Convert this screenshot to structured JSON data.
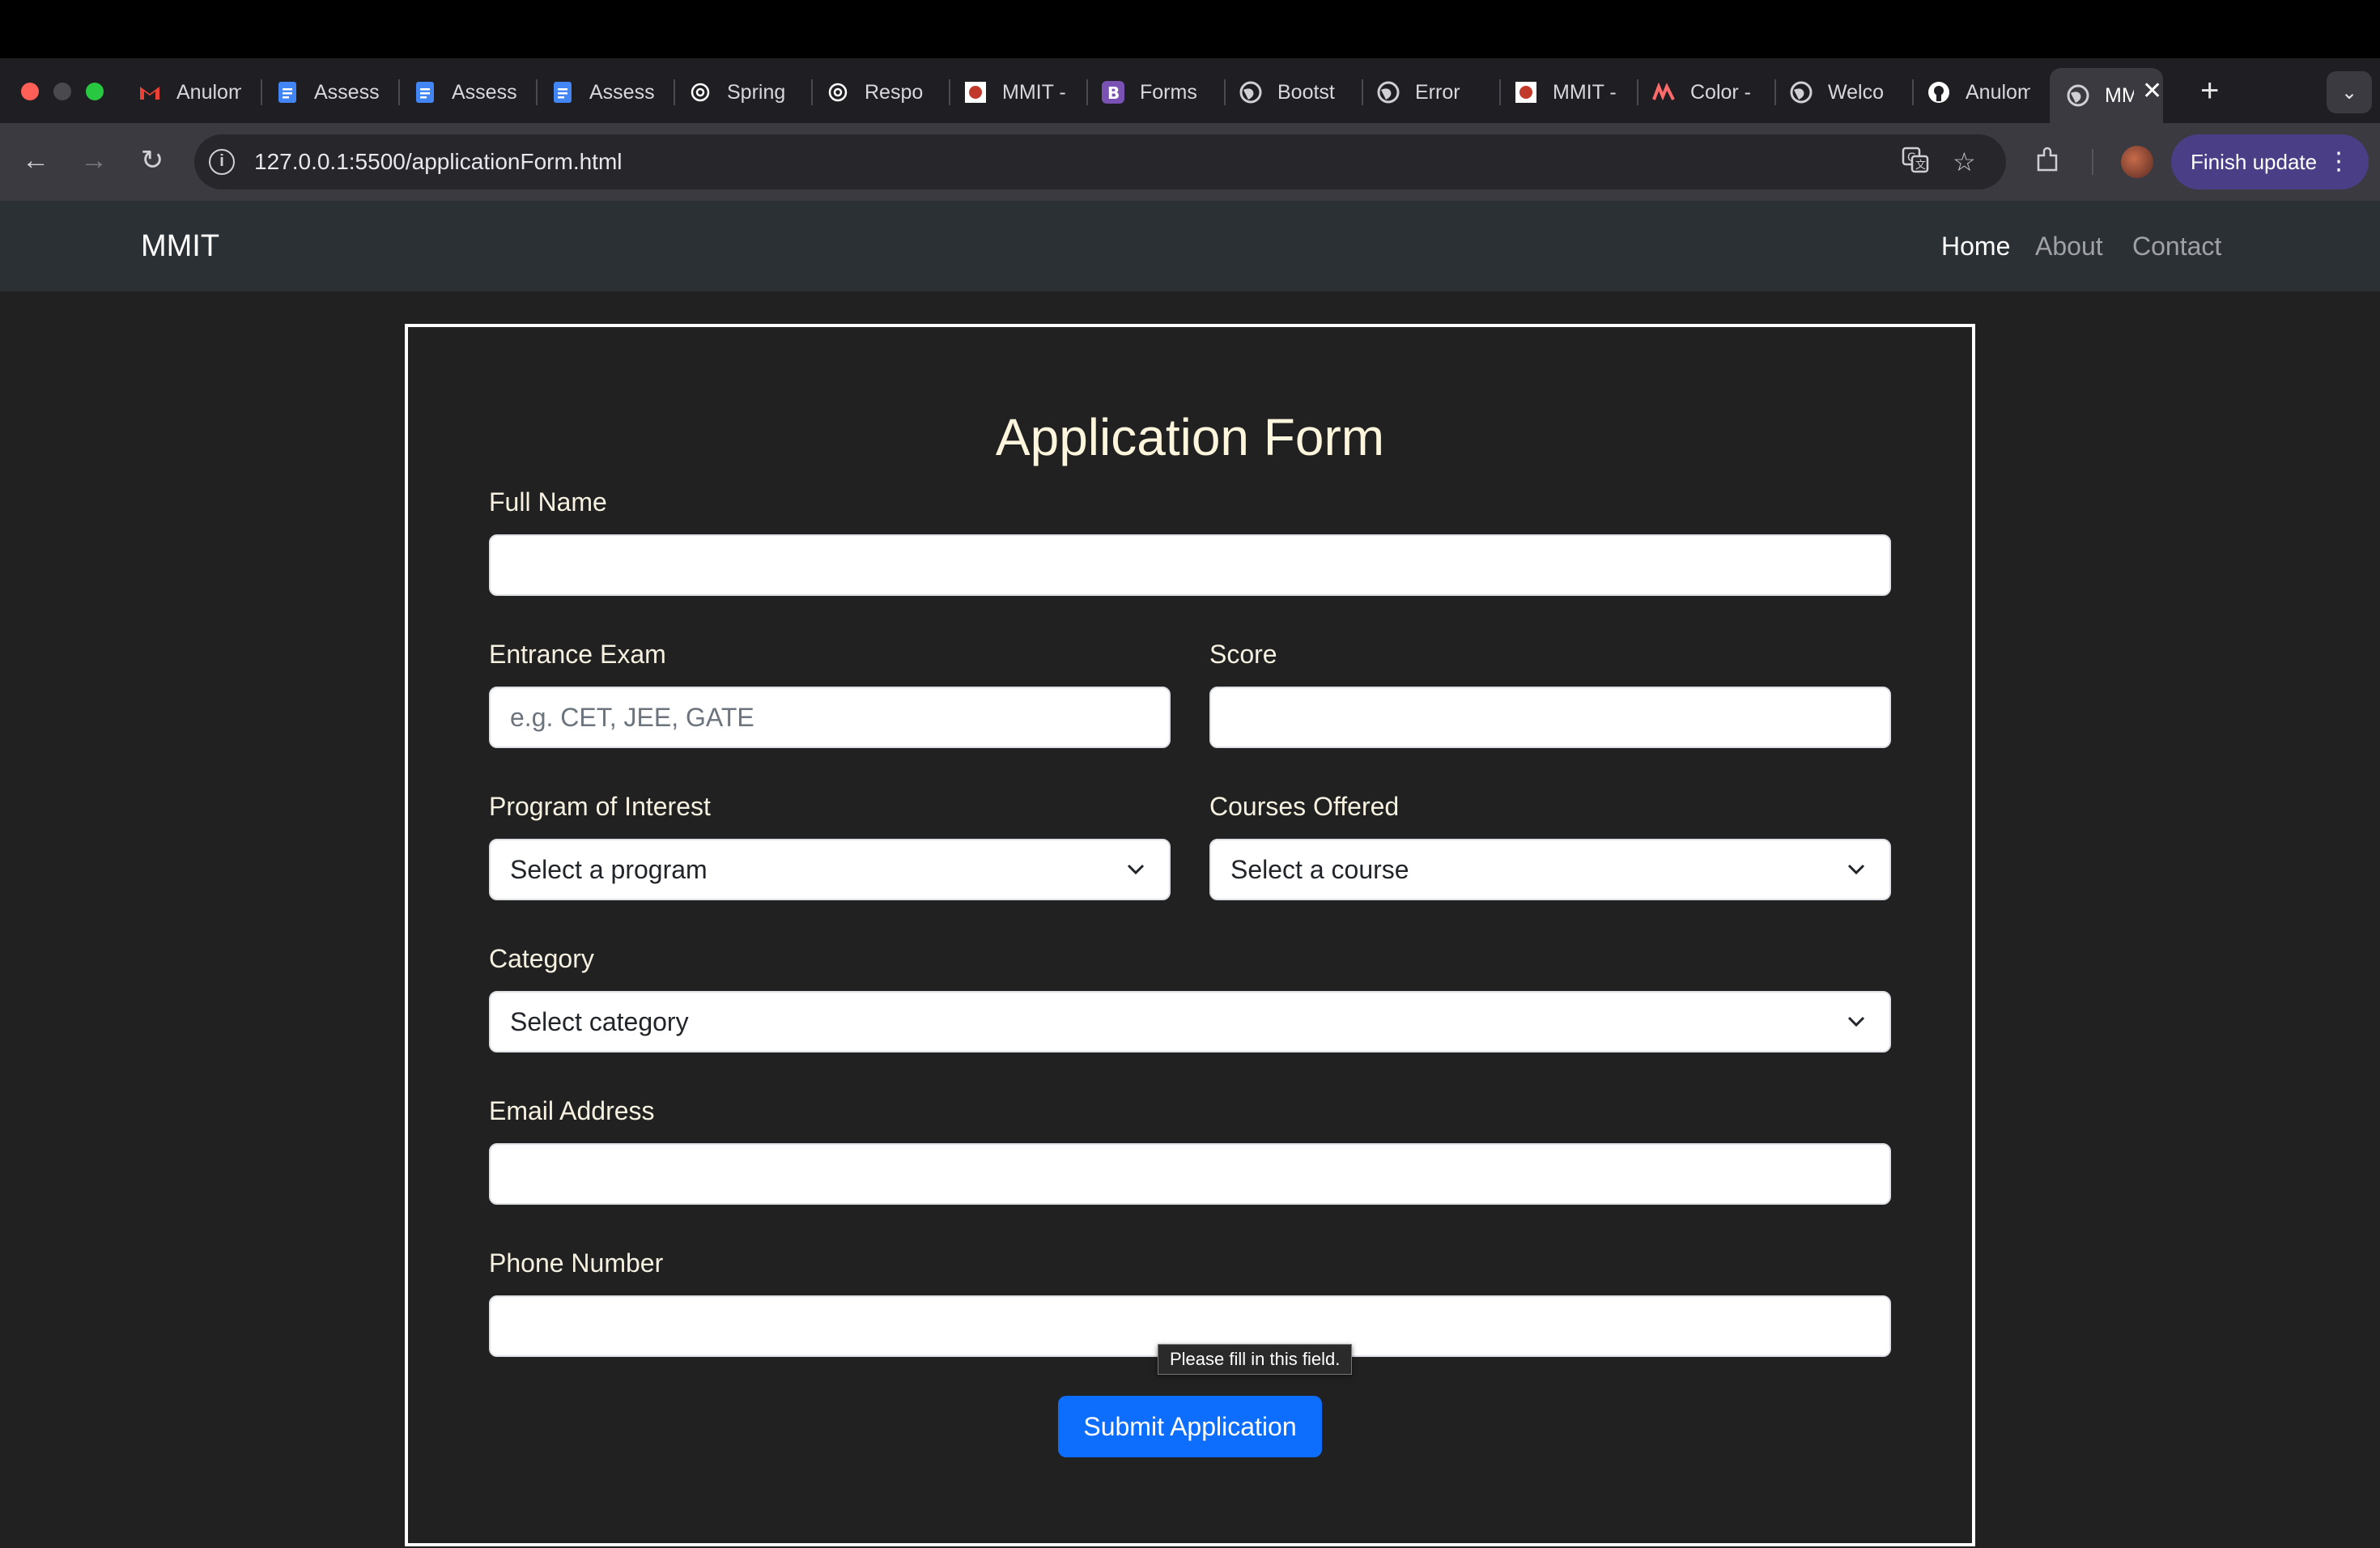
{
  "browser": {
    "tabs": [
      {
        "title": "Anulom",
        "icon": "gmail-icon",
        "color": "#ea4335"
      },
      {
        "title": "Assess",
        "icon": "docs-icon",
        "color": "#4285f4"
      },
      {
        "title": "Assess",
        "icon": "docs-icon",
        "color": "#4285f4"
      },
      {
        "title": "Assess",
        "icon": "docs-icon",
        "color": "#4285f4"
      },
      {
        "title": "Spring",
        "icon": "openai-icon",
        "color": "#ffffff"
      },
      {
        "title": "Respo",
        "icon": "openai-icon",
        "color": "#ffffff"
      },
      {
        "title": "MMIT -",
        "icon": "mmit-logo-icon",
        "color": "#c0392b"
      },
      {
        "title": "Forms",
        "icon": "bootstrap-icon",
        "color": "#7952b3"
      },
      {
        "title": "Bootst",
        "icon": "globe-icon",
        "color": "#d0d0d4"
      },
      {
        "title": "Error",
        "icon": "globe-icon",
        "color": "#d0d0d4"
      },
      {
        "title": "MMIT -",
        "icon": "mmit-logo-icon",
        "color": "#c0392b"
      },
      {
        "title": "Color -",
        "icon": "coolors-icon",
        "color": "#ff6b6b"
      },
      {
        "title": "Welco",
        "icon": "globe-icon",
        "color": "#d0d0d4"
      },
      {
        "title": "Anulom",
        "icon": "github-icon",
        "color": "#ffffff"
      }
    ],
    "active_tab": {
      "title": "MM",
      "icon": "globe-icon"
    },
    "url": "127.0.0.1:5500/applicationForm.html",
    "finish_update": "Finish update"
  },
  "navbar": {
    "brand": "MMIT",
    "links": [
      {
        "label": "Home",
        "active": true
      },
      {
        "label": "About",
        "active": false
      },
      {
        "label": "Contact",
        "active": false
      }
    ]
  },
  "form": {
    "title": "Application Form",
    "full_name": {
      "label": "Full Name",
      "value": ""
    },
    "entrance_exam": {
      "label": "Entrance Exam",
      "placeholder": "e.g. CET, JEE, GATE"
    },
    "score": {
      "label": "Score",
      "value": ""
    },
    "program": {
      "label": "Program of Interest",
      "selected": "Select a program"
    },
    "courses": {
      "label": "Courses Offered",
      "selected": "Select a course"
    },
    "category": {
      "label": "Category",
      "selected": "Select category"
    },
    "email": {
      "label": "Email Address",
      "value": ""
    },
    "phone": {
      "label": "Phone Number",
      "value": ""
    },
    "validation_tooltip": "Please fill in this field.",
    "submit_label": "Submit Application"
  },
  "colors": {
    "primary": "#0d6efd",
    "page_bg": "#212121",
    "navbar_bg": "#2b3035",
    "label": "#f7f1e1"
  }
}
